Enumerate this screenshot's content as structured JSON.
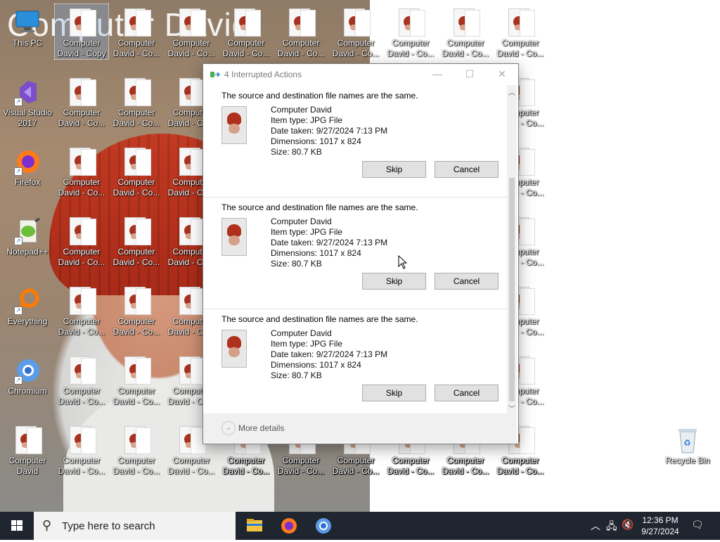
{
  "desktop": {
    "background_title": "Computer David",
    "system_icons": [
      {
        "label": "This PC",
        "icon": "monitor-icon"
      },
      {
        "label": "Visual Studio 2017",
        "icon": "visual-studio-icon"
      },
      {
        "label": "Firefox",
        "icon": "firefox-icon"
      },
      {
        "label": "Notepad++",
        "icon": "notepad-plus-plus-icon"
      },
      {
        "label": "Everything",
        "icon": "everything-search-icon"
      },
      {
        "label": "Chromium",
        "icon": "chromium-icon"
      },
      {
        "label": "Computer David",
        "icon": "image-file-icon"
      },
      {
        "label": "Recycle Bin",
        "icon": "recycle-bin-icon"
      }
    ],
    "file_label_first": "Computer David - Copy",
    "file_label_short": "Computer David - Co..."
  },
  "dialog": {
    "title": "4 Interrupted Actions",
    "items": [
      {
        "message": "The source and destination file names are the same.",
        "name": "Computer David",
        "item_type": "Item type: JPG File",
        "date_taken": "Date taken: 9/27/2024 7:13 PM",
        "dimensions": "Dimensions: 1017 x 824",
        "size": "Size: 80.7 KB",
        "skip_label": "Skip",
        "cancel_label": "Cancel"
      },
      {
        "message": "The source and destination file names are the same.",
        "name": "Computer David",
        "item_type": "Item type: JPG File",
        "date_taken": "Date taken: 9/27/2024 7:13 PM",
        "dimensions": "Dimensions: 1017 x 824",
        "size": "Size: 80.7 KB",
        "skip_label": "Skip",
        "cancel_label": "Cancel"
      },
      {
        "message": "The source and destination file names are the same.",
        "name": "Computer David",
        "item_type": "Item type: JPG File",
        "date_taken": "Date taken: 9/27/2024 7:13 PM",
        "dimensions": "Dimensions: 1017 x 824",
        "size": "Size: 80.7 KB",
        "skip_label": "Skip",
        "cancel_label": "Cancel"
      }
    ],
    "more_details": "More details"
  },
  "taskbar": {
    "search_placeholder": "Type here to search",
    "time": "12:36 PM",
    "date": "9/27/2024"
  }
}
